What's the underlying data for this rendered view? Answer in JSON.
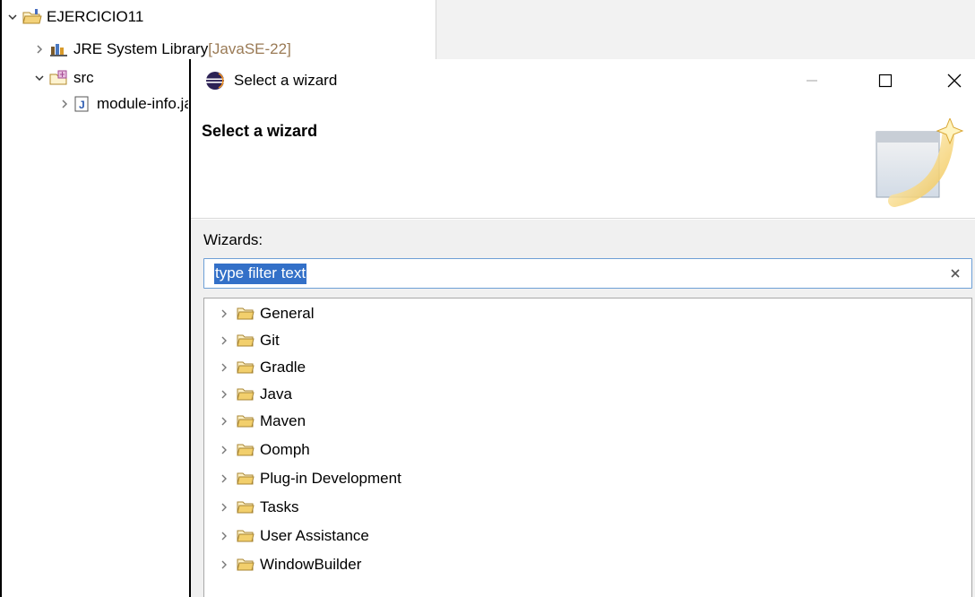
{
  "explorer": {
    "items": [
      {
        "label": "EJERCICIO11",
        "suffix": "",
        "expanded": true,
        "icon": "project-icon"
      },
      {
        "label": "JRE System Library ",
        "suffix": "[JavaSE-22]",
        "expanded": false,
        "icon": "library-icon"
      },
      {
        "label": "src",
        "suffix": "",
        "expanded": true,
        "icon": "package-folder-icon"
      },
      {
        "label": "module-info.java",
        "suffix": "",
        "expanded": false,
        "icon": "java-file-icon"
      }
    ]
  },
  "dialog": {
    "window_title": "Select a wizard",
    "banner_title": "Select a wizard",
    "wizards_label": "Wizards:",
    "filter": {
      "value": "type filter text",
      "clear_icon": "clear-icon"
    },
    "wizards": [
      "General",
      "Git",
      "Gradle",
      "Java",
      "Maven",
      "Oomph",
      "Plug-in Development",
      "Tasks",
      "User Assistance",
      "WindowBuilder"
    ]
  },
  "colors": {
    "selection": "#3370c8",
    "folder": "#e8c45a",
    "eclipse_purple": "#2c2255"
  }
}
